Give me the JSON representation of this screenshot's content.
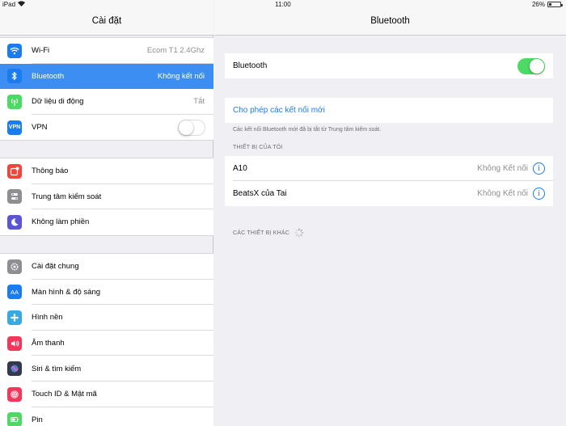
{
  "status_bar": {
    "device": "iPad",
    "time": "11:00",
    "battery": "26%",
    "battery_level": 0.26
  },
  "sidebar": {
    "title": "Cài đặt",
    "groups": [
      [
        {
          "label": "Wi-Fi",
          "value": "Ecom T1 2.4Ghz",
          "icon": "wifi-icon",
          "color": "#1a7cf0"
        },
        {
          "label": "Bluetooth",
          "value": "Không kết nối",
          "icon": "bluetooth-icon",
          "color": "#1a7cf0",
          "selected": true
        },
        {
          "label": "Dữ liệu di động",
          "value": "Tắt",
          "icon": "cellular-icon",
          "color": "#4cd964"
        },
        {
          "label": "VPN",
          "value": "",
          "icon": "vpn-icon",
          "color": "#1a7cf0",
          "toggle": "off"
        }
      ],
      [
        {
          "label": "Thông báo",
          "icon": "notifications-icon",
          "color": "#f2443a"
        },
        {
          "label": "Trung tâm kiểm soát",
          "icon": "control-center-icon",
          "color": "#8e8e93"
        },
        {
          "label": "Không làm phiền",
          "icon": "moon-icon",
          "color": "#5a54d6"
        }
      ],
      [
        {
          "label": "Cài đặt chung",
          "icon": "gear-icon",
          "color": "#8e8e93"
        },
        {
          "label": "Màn hình & độ sáng",
          "icon": "display-icon",
          "color": "#1a7cf0"
        },
        {
          "label": "Hình nền",
          "icon": "wallpaper-icon",
          "color": "#35a9e0"
        },
        {
          "label": "Âm thanh",
          "icon": "sound-icon",
          "color": "#f2375b"
        },
        {
          "label": "Siri & tìm kiếm",
          "icon": "siri-icon",
          "color": "#333a4d"
        },
        {
          "label": "Touch ID & Mật mã",
          "icon": "fingerprint-icon",
          "color": "#f2375b"
        },
        {
          "label": "Pin",
          "icon": "battery-icon",
          "color": "#4cd964"
        }
      ]
    ]
  },
  "detail": {
    "title": "Bluetooth",
    "bluetooth_label": "Bluetooth",
    "bluetooth_on": true,
    "allow_new_label": "Cho phép các kết nối mới",
    "footnote": "Các kết nối Bluetooth mới đã bị tắt từ Trung tâm kiểm soát.",
    "my_devices_header": "THIẾT BỊ CỦA TÔI",
    "devices": [
      {
        "name": "A10",
        "status": "Không Kết nối"
      },
      {
        "name": "BeatsX của Tai",
        "status": "Không Kết nối"
      }
    ],
    "other_devices_header": "CÁC THIẾT BỊ KHÁC"
  }
}
